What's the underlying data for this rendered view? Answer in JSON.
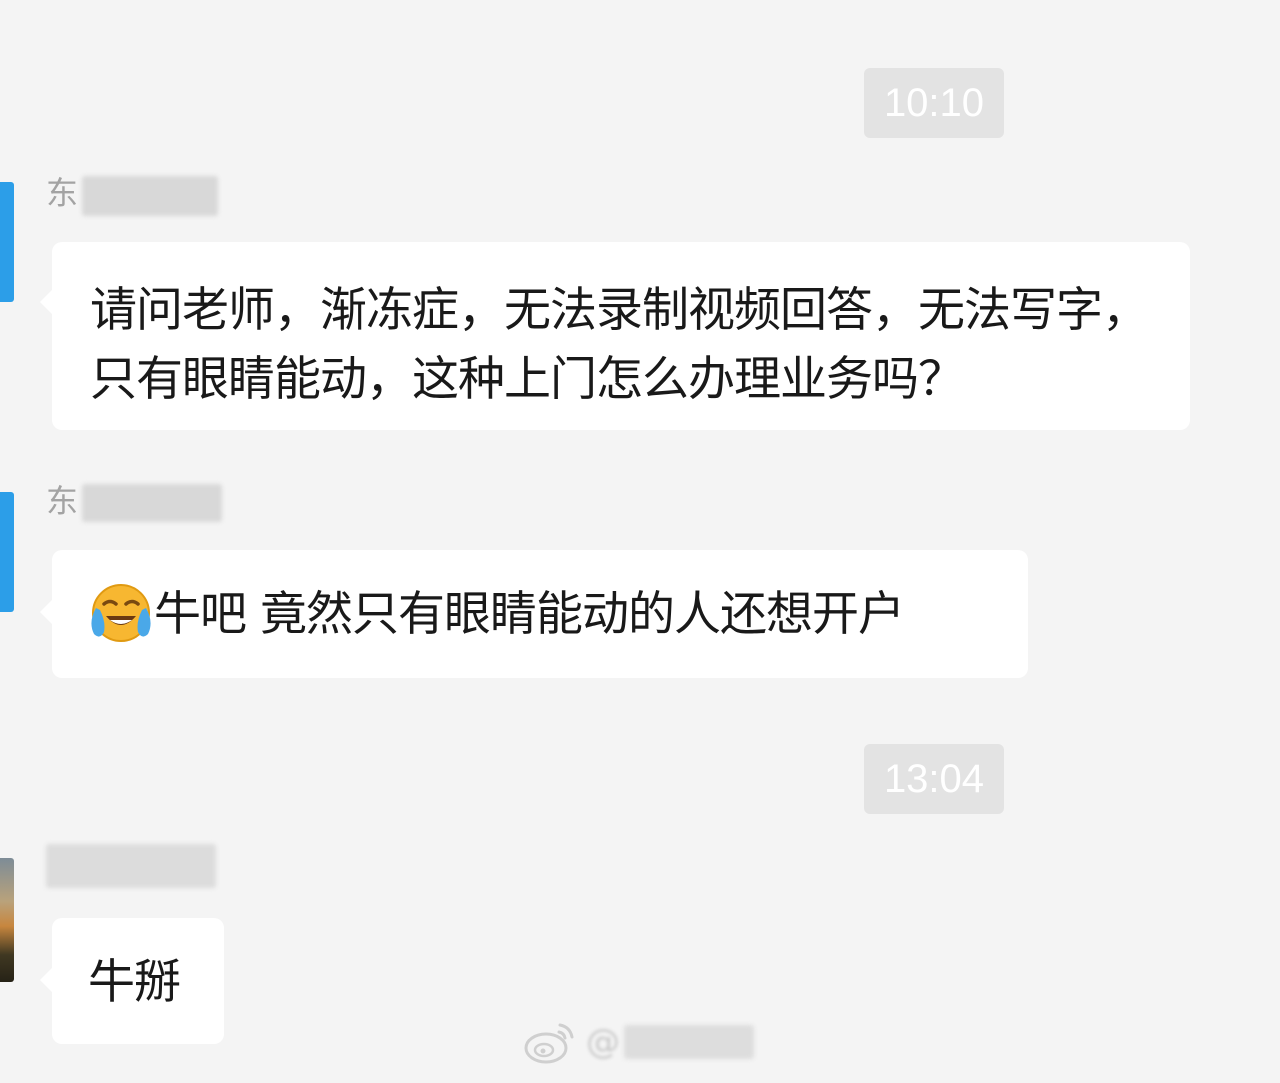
{
  "timestamps": {
    "first": "10:10",
    "second": "13:04"
  },
  "messages": [
    {
      "sender_visible": "东",
      "text": "请问老师，渐冻症，无法录制视频回答，无法写字，只有眼睛能动，这种上门怎么办理业务吗？",
      "avatar_color": "#2c9ee8"
    },
    {
      "sender_visible": "东",
      "emoji": "crying-laughing-emoji",
      "text": "牛吧 竟然只有眼睛能动的人还想开户",
      "avatar_color": "#2c9ee8"
    },
    {
      "sender_visible": "",
      "text": "牛掰",
      "avatar": "photo"
    }
  ],
  "watermark": {
    "icon": "weibo-icon",
    "text": "@"
  },
  "colors": {
    "background": "#f4f4f4",
    "bubble": "#ffffff",
    "timestamp_bg": "#e3e3e3",
    "sender_text": "#a3a3a3"
  }
}
